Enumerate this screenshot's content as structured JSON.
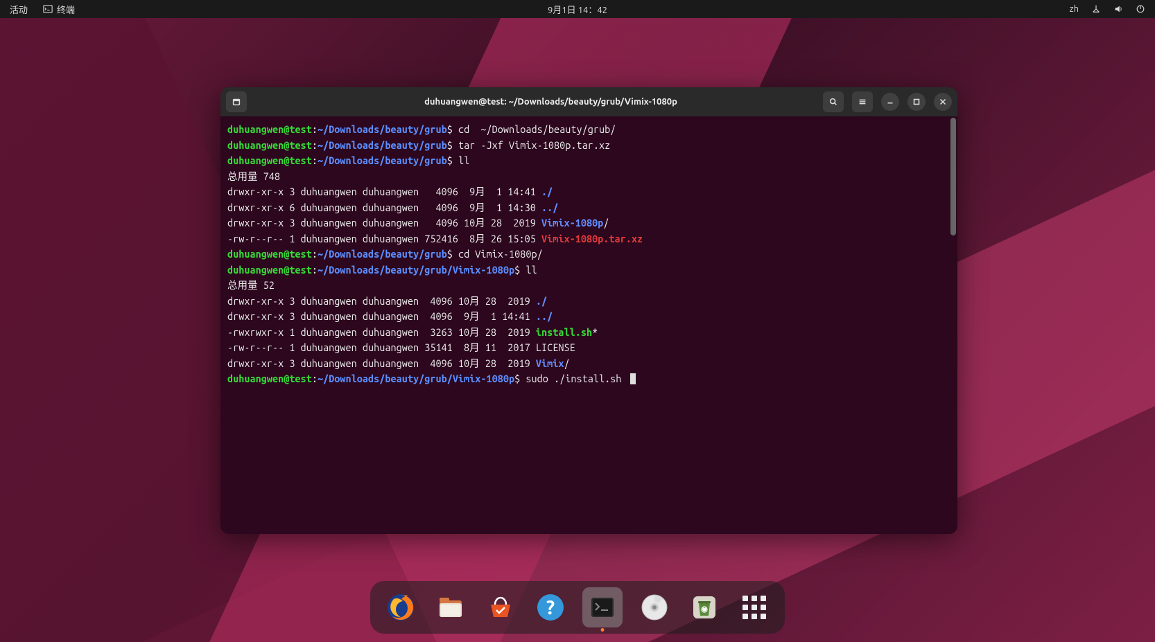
{
  "topbar": {
    "activities": "活动",
    "app_label": "终端",
    "datetime": "9月1日 14：42",
    "ime": "zh"
  },
  "window": {
    "title": "duhuangwen@test: ~/Downloads/beauty/grub/Vimix-1080p"
  },
  "prompt": {
    "user1": "duhuangwen@test",
    "colon": ":",
    "path1": "~/Downloads/beauty/grub",
    "path2": "~/Downloads/beauty/grub/Vimix-1080p",
    "dollar": "$"
  },
  "cmds": {
    "cd1": " cd  ~/Downloads/beauty/grub/",
    "tar": " tar -Jxf Vimix-1080p.tar.xz",
    "ll": " ll",
    "cd2": " cd Vimix-1080p/",
    "sudo": " sudo ./install.sh "
  },
  "output": {
    "total1": "总用量 748",
    "l1a": "drwxr-xr-x 3 duhuangwen duhuangwen   4096  9月  1 14:41 ",
    "l1b": "./",
    "l2a": "drwxr-xr-x 6 duhuangwen duhuangwen   4096  9月  1 14:30 ",
    "l2b": "../",
    "l3a": "drwxr-xr-x 3 duhuangwen duhuangwen   4096 10月 28  2019 ",
    "l3b": "Vimix-1080p",
    "l3c": "/",
    "l4a": "-rw-r--r-- 1 duhuangwen duhuangwen 752416  8月 26 15:05 ",
    "l4b": "Vimix-1080p.tar.xz",
    "total2": "总用量 52",
    "m1a": "drwxr-xr-x 3 duhuangwen duhuangwen  4096 10月 28  2019 ",
    "m1b": "./",
    "m2a": "drwxr-xr-x 3 duhuangwen duhuangwen  4096  9月  1 14:41 ",
    "m2b": "../",
    "m3a": "-rwxrwxr-x 1 duhuangwen duhuangwen  3263 10月 28  2019 ",
    "m3b": "install.sh",
    "m3c": "*",
    "m4a": "-rw-r--r-- 1 duhuangwen duhuangwen 35141  8月 11  2017 LICENSE",
    "m5a": "drwxr-xr-x 3 duhuangwen duhuangwen  4096 10月 28  2019 ",
    "m5b": "Vimix",
    "m5c": "/"
  },
  "dock": {
    "items": [
      "firefox",
      "files",
      "software",
      "help",
      "terminal",
      "disc",
      "trash",
      "apps"
    ]
  }
}
